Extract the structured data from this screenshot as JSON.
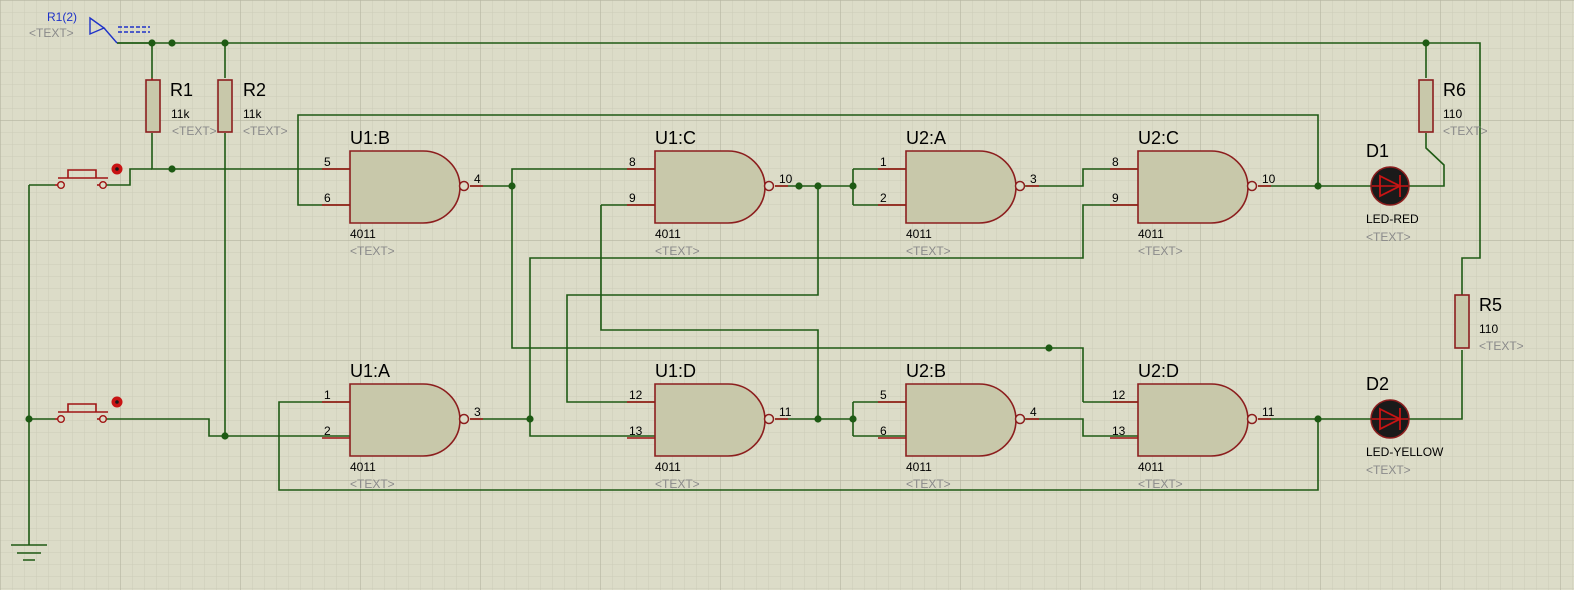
{
  "gates": [
    {
      "name": "U1:B",
      "part": "4011",
      "text": "<TEXT>",
      "pin_a": "5",
      "pin_b": "6",
      "pin_out": "4"
    },
    {
      "name": "U1:C",
      "part": "4011",
      "text": "<TEXT>",
      "pin_a": "8",
      "pin_b": "9",
      "pin_out": "10"
    },
    {
      "name": "U2:A",
      "part": "4011",
      "text": "<TEXT>",
      "pin_a": "1",
      "pin_b": "2",
      "pin_out": "3"
    },
    {
      "name": "U2:C",
      "part": "4011",
      "text": "<TEXT>",
      "pin_a": "8",
      "pin_b": "9",
      "pin_out": "10"
    },
    {
      "name": "U1:A",
      "part": "4011",
      "text": "<TEXT>",
      "pin_a": "1",
      "pin_b": "2",
      "pin_out": "3"
    },
    {
      "name": "U1:D",
      "part": "4011",
      "text": "<TEXT>",
      "pin_a": "12",
      "pin_b": "13",
      "pin_out": "11"
    },
    {
      "name": "U2:B",
      "part": "4011",
      "text": "<TEXT>",
      "pin_a": "5",
      "pin_b": "6",
      "pin_out": "4"
    },
    {
      "name": "U2:D",
      "part": "4011",
      "text": "<TEXT>",
      "pin_a": "12",
      "pin_b": "13",
      "pin_out": "11"
    }
  ],
  "resistors": [
    {
      "name": "R1",
      "value": "11k",
      "text": "<TEXT>"
    },
    {
      "name": "R2",
      "value": "11k",
      "text": "<TEXT>"
    },
    {
      "name": "R6",
      "value": "110",
      "text": "<TEXT>"
    },
    {
      "name": "R5",
      "value": "110",
      "text": "<TEXT>"
    }
  ],
  "leds": [
    {
      "name": "D1",
      "type": "LED-RED",
      "text": "<TEXT>",
      "color": "#c81414"
    },
    {
      "name": "D2",
      "type": "LED-YELLOW",
      "text": "<TEXT>",
      "color": "#c81414"
    }
  ],
  "terminal": {
    "label": "R1(2)",
    "text": "<TEXT>"
  },
  "colors": {
    "background": "#dcdcc8",
    "grid": "#c4c4b0",
    "wire": "#1e5a14",
    "component_outline": "#8c1e1e",
    "component_fill": "#c8c8aa"
  }
}
